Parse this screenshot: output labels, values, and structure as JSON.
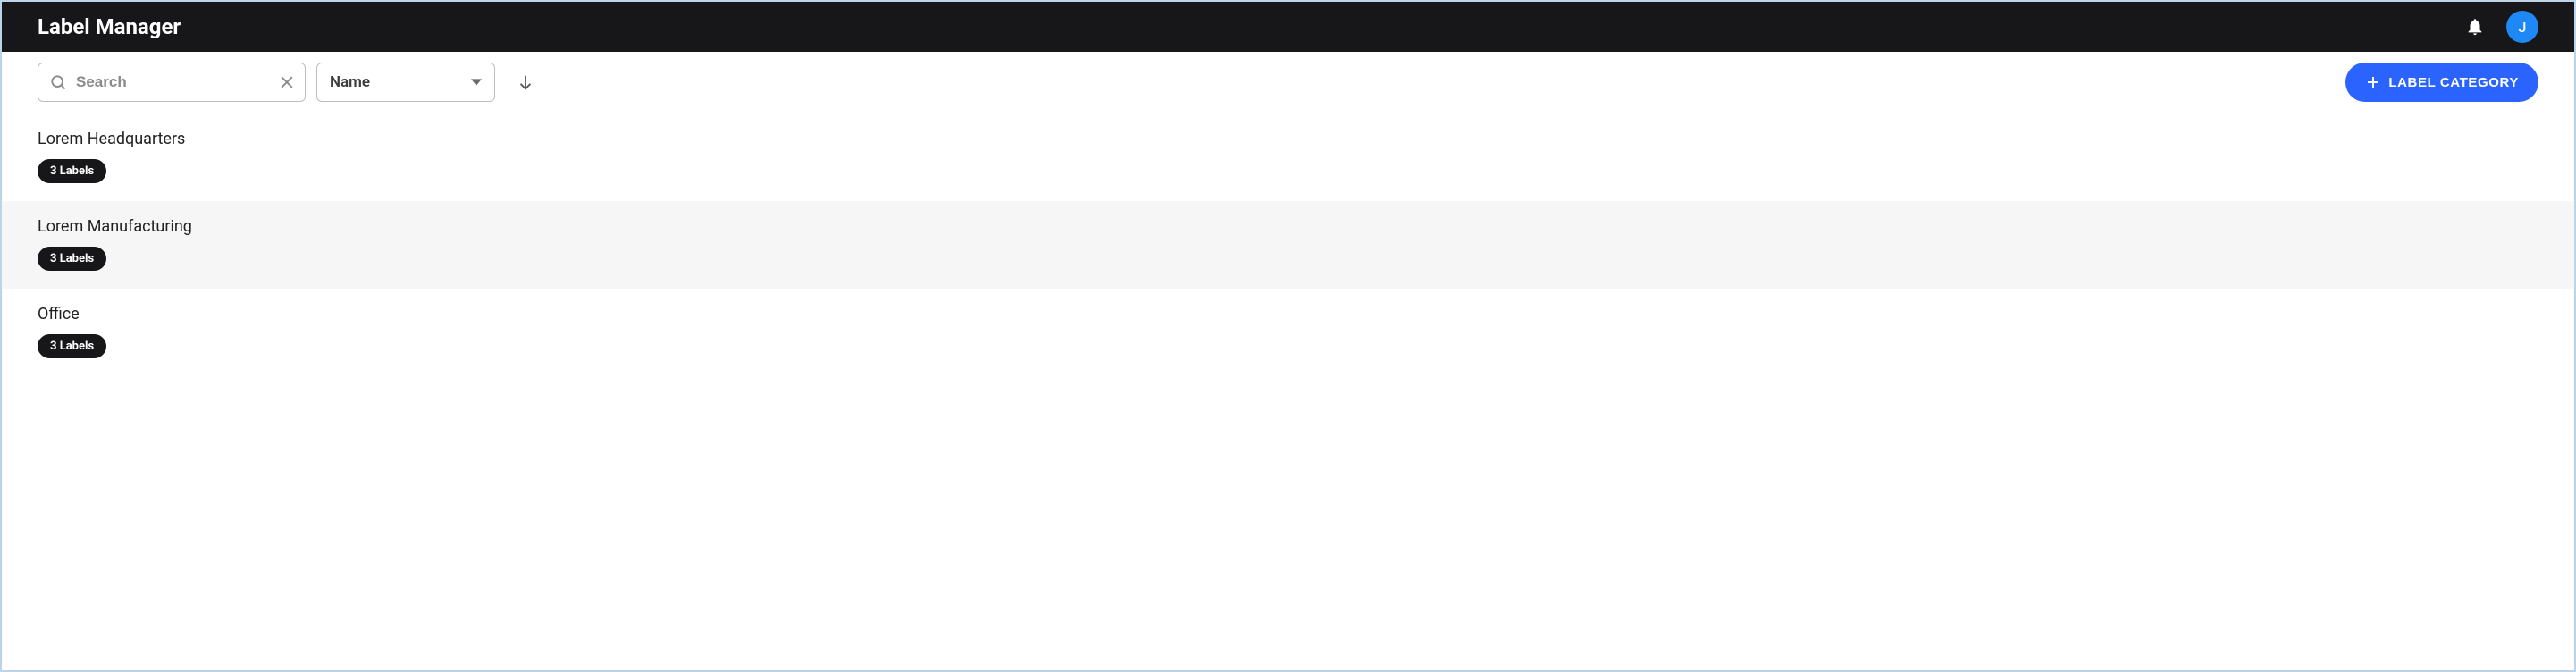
{
  "header": {
    "title": "Label Manager",
    "avatar_initial": "J"
  },
  "toolbar": {
    "search_placeholder": "Search",
    "search_value": "",
    "sort_by": "Name",
    "add_button_label": "LABEL CATEGORY"
  },
  "categories": [
    {
      "name": "Lorem Headquarters",
      "badge": "3 Labels",
      "highlight": false
    },
    {
      "name": "Lorem Manufacturing",
      "badge": "3 Labels",
      "highlight": true
    },
    {
      "name": "Office",
      "badge": "3 Labels",
      "highlight": false
    }
  ]
}
